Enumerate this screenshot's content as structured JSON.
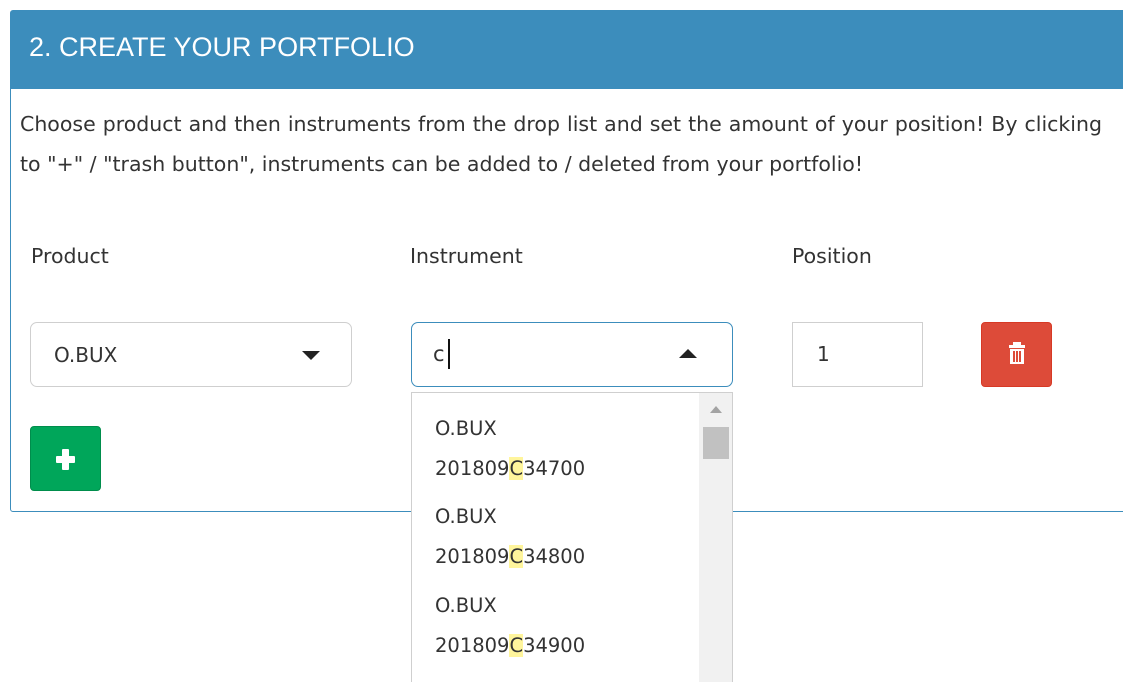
{
  "panel": {
    "title": "2. CREATE YOUR PORTFOLIO",
    "description": "Choose product and then instruments from the drop list and set the amount of your position! By clicking to \"+\" / \"trash button\", instruments can be added to / deleted from your portfolio!"
  },
  "labels": {
    "product": "Product",
    "instrument": "Instrument",
    "position": "Position"
  },
  "product_select": {
    "value": "O.BUX"
  },
  "instrument_select": {
    "typed_value": "c"
  },
  "position_input": {
    "value": "1"
  },
  "buttons": {
    "trash_icon": "trash-icon",
    "add_icon": "plus-icon"
  },
  "dropdown": {
    "options": [
      {
        "line1": "O.BUX",
        "prefix": "201809",
        "match": "C",
        "suffix": "34700"
      },
      {
        "line1": "O.BUX",
        "prefix": "201809",
        "match": "C",
        "suffix": "34800"
      },
      {
        "line1": "O.BUX",
        "prefix": "201809",
        "match": "C",
        "suffix": "34900"
      }
    ]
  },
  "colors": {
    "header": "#3c8dbc",
    "trash_button": "#dd4b39",
    "add_button": "#00a65a",
    "match_highlight": "#fff59c"
  }
}
